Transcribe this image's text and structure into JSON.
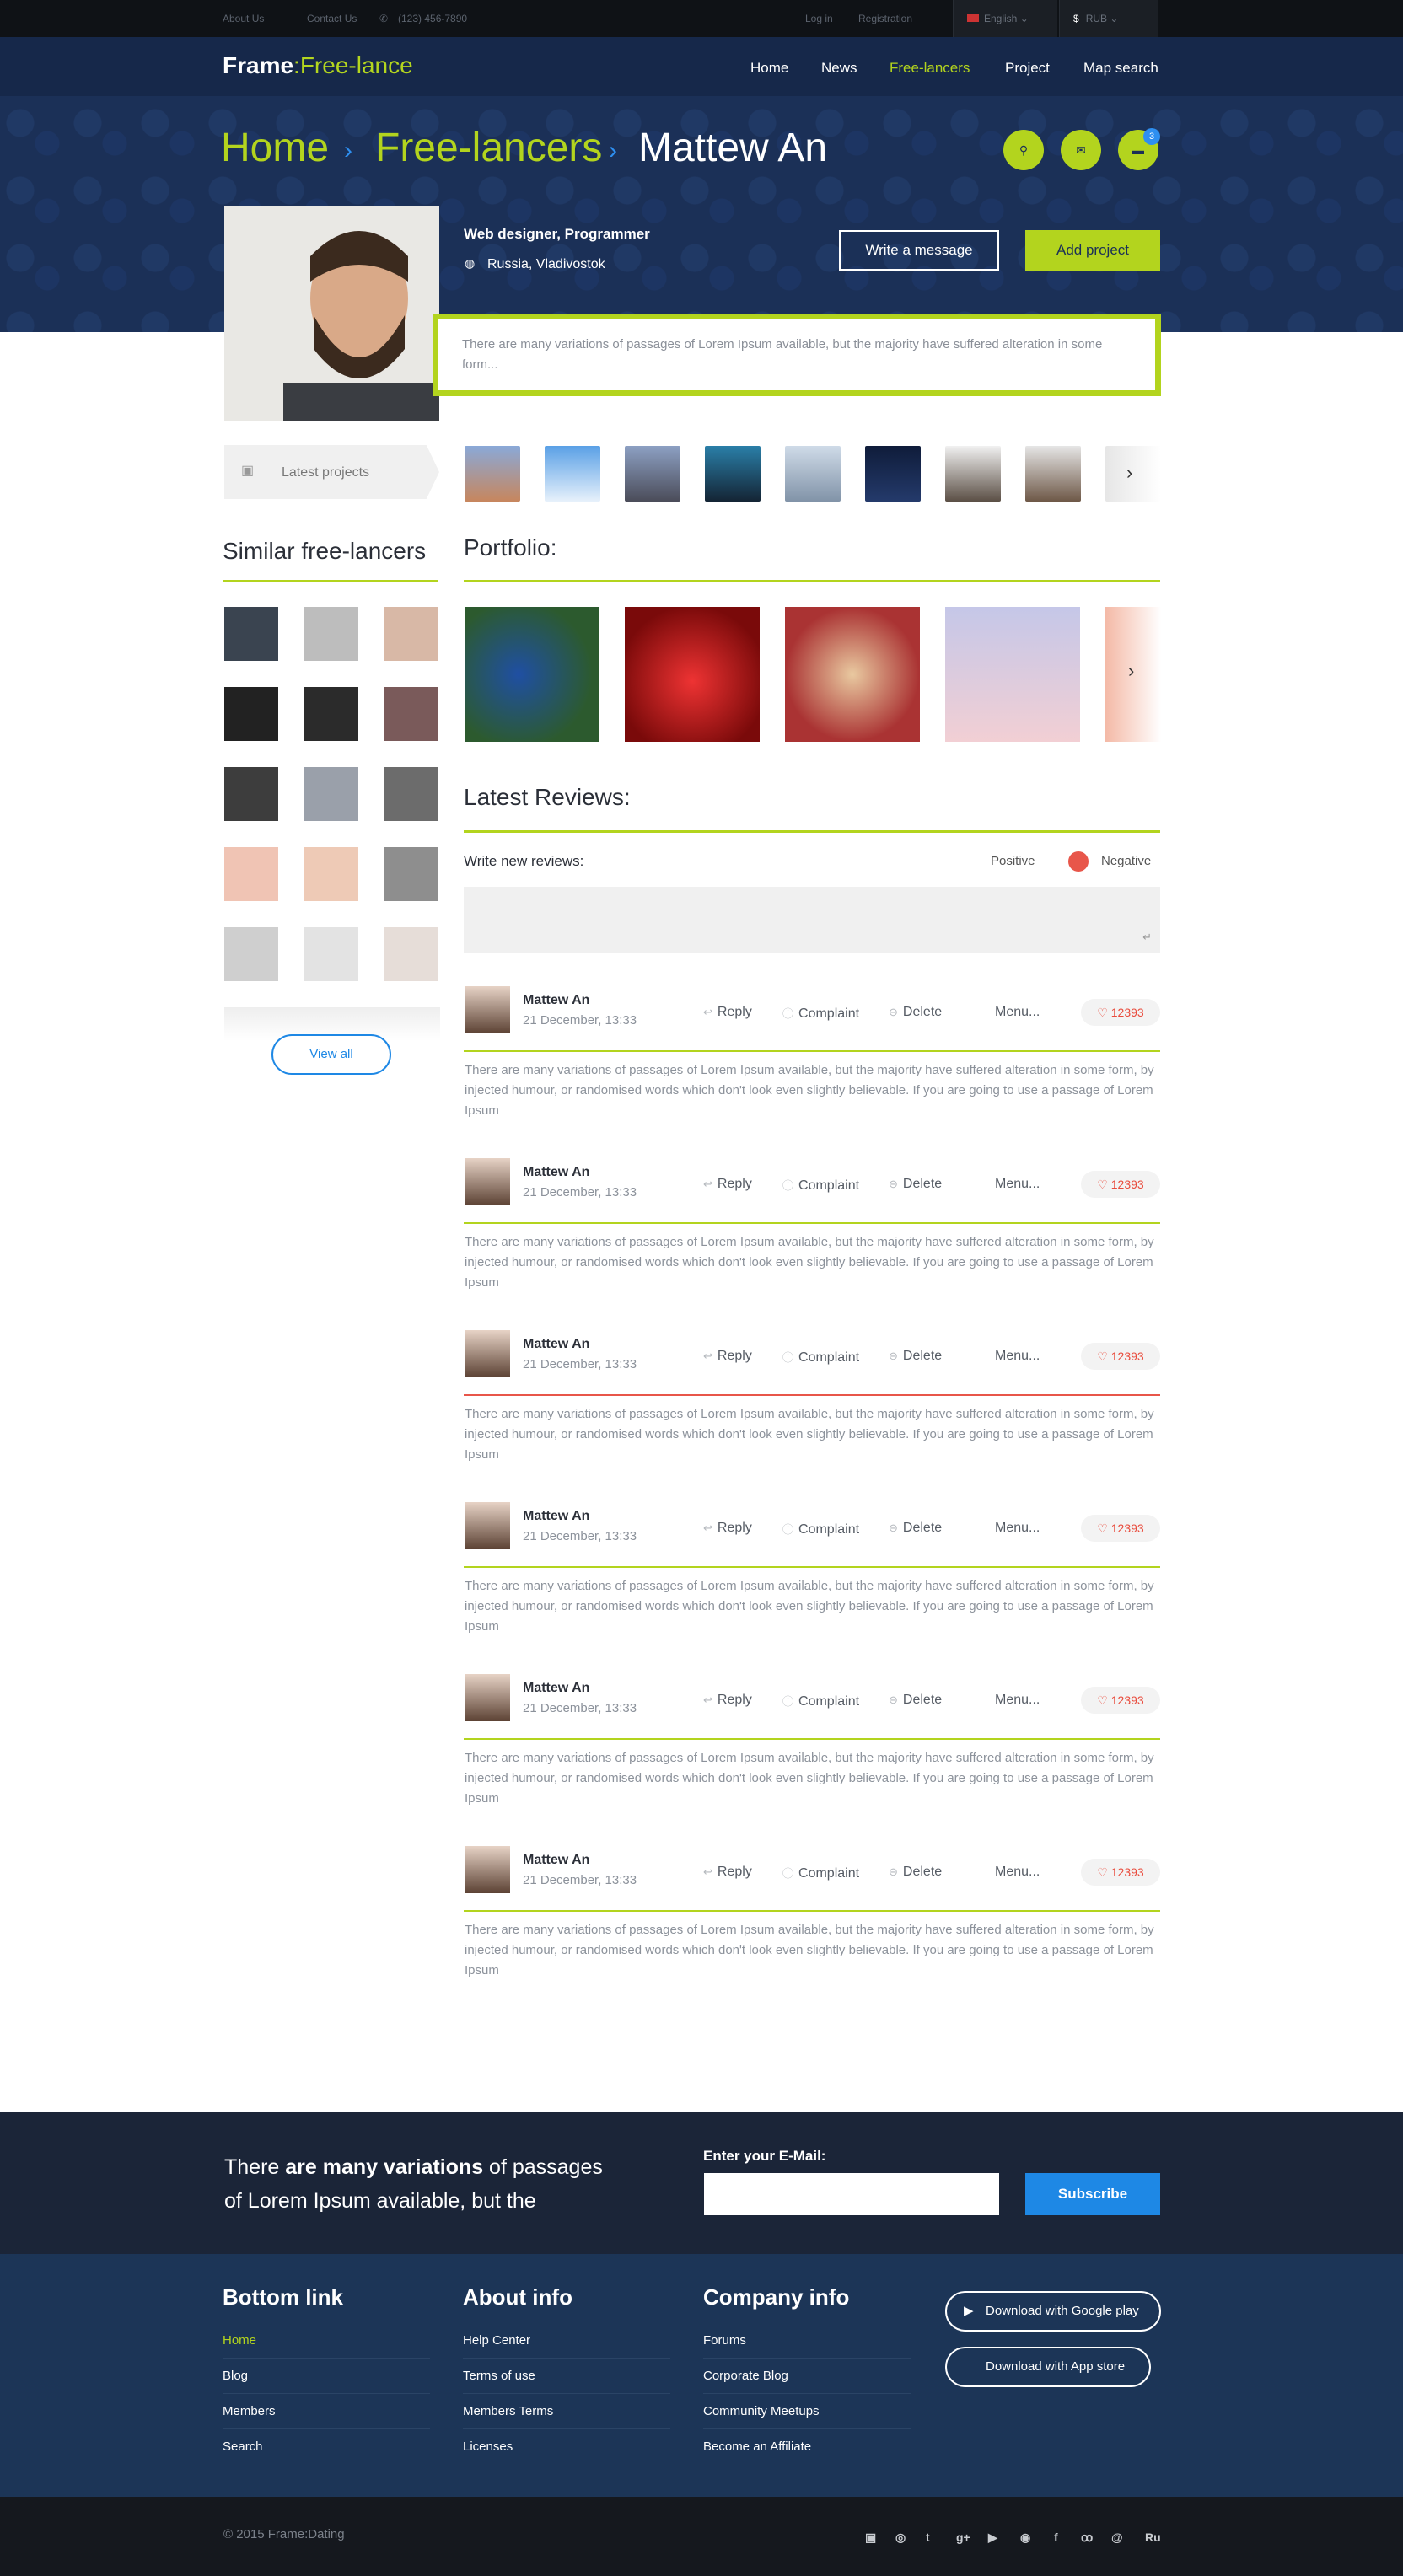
{
  "topbar": {
    "about": "About Us",
    "contact": "Contact Us",
    "phone": "(123) 456-7890",
    "login": "Log in",
    "register": "Registration",
    "language": "English",
    "currency": "RUB"
  },
  "brand": {
    "bold": "Frame",
    "sep": ":",
    "light": "Free-lance"
  },
  "nav": [
    "Home",
    "News",
    "Free-lancers",
    "Project",
    "Map search"
  ],
  "breadcrumb": {
    "home": "Home",
    "section": "Free-lancers",
    "current": "Mattew An"
  },
  "notifications": {
    "count": "3"
  },
  "profile": {
    "role": "Web designer, Programmer",
    "location": "Russia, Vladivostok",
    "write_message": "Write a message",
    "add_project": "Add project",
    "quote": "There are many variations of passages of Lorem Ipsum available, but the majority have suffered alteration in some form..."
  },
  "latest_projects": {
    "label": "Latest projects"
  },
  "similar": {
    "title": "Similar free-lancers",
    "view_all": "View all"
  },
  "portfolio": {
    "title": "Portfolio:"
  },
  "reviews": {
    "title": "Latest Reviews:",
    "write_label": "Write new reviews:",
    "positive": "Positive",
    "negative": "Negative",
    "items": [
      {
        "name": "Mattew An",
        "date": "21 December, 13:33",
        "likes": "12393",
        "text": "There are many variations of passages of Lorem Ipsum available, but the majority have suffered alteration in some form, by injected humour, or randomised words which don't look even slightly believable. If you are going to use a passage of Lorem Ipsum",
        "line": "#b3d41e"
      },
      {
        "name": "Mattew An",
        "date": "21 December, 13:33",
        "likes": "12393",
        "text": "There are many variations of passages of Lorem Ipsum available, but the majority have suffered alteration in some form, by injected humour, or randomised words which don't look even slightly believable. If you are going to use a passage of Lorem Ipsum",
        "line": "#b3d41e"
      },
      {
        "name": "Mattew An",
        "date": "21 December, 13:33",
        "likes": "12393",
        "text": "There are many variations of passages of Lorem Ipsum available, but the majority have suffered alteration in some form, by injected humour, or randomised words which don't look even slightly believable. If you are going to use a passage of Lorem Ipsum",
        "line": "#e8564a"
      },
      {
        "name": "Mattew An",
        "date": "21 December, 13:33",
        "likes": "12393",
        "text": "There are many variations of passages of Lorem Ipsum available, but the majority have suffered alteration in some form, by injected humour, or randomised words which don't look even slightly believable. If you are going to use a passage of Lorem Ipsum",
        "line": "#b3d41e"
      },
      {
        "name": "Mattew An",
        "date": "21 December, 13:33",
        "likes": "12393",
        "text": "There are many variations of passages of Lorem Ipsum available, but the majority have suffered alteration in some form, by injected humour, or randomised words which don't look even slightly believable. If you are going to use a passage of Lorem Ipsum",
        "line": "#b3d41e"
      },
      {
        "name": "Mattew An",
        "date": "21 December, 13:33",
        "likes": "12393",
        "text": "There are many variations of passages of Lorem Ipsum available, but the majority have suffered alteration in some form, by injected humour, or randomised words which don't look even slightly believable. If you are going to use a passage of Lorem Ipsum",
        "line": "#b3d41e"
      }
    ],
    "actions": {
      "reply": "Reply",
      "complaint": "Complaint",
      "delete": "Delete",
      "menu": "Menu..."
    }
  },
  "subscribe": {
    "line1_pre": "There ",
    "line1_bold": "are many variations",
    "line1_post": " of passages",
    "line2": "of Lorem Ipsum available, but the",
    "email_label": "Enter your E-Mail:",
    "button": "Subscribe"
  },
  "footer": {
    "col1": {
      "title": "Bottom link",
      "links": [
        "Home",
        "Blog",
        "Members",
        "Search"
      ]
    },
    "col2": {
      "title": "About info",
      "links": [
        "Help Center",
        "Terms of use",
        "Members Terms",
        "Licenses"
      ]
    },
    "col3": {
      "title": "Company info",
      "links": [
        "Forums",
        "Corporate Blog",
        "Community Meetups",
        "Become an Affiliate"
      ]
    },
    "google": "Download with Google play",
    "appstore": "Download with App store",
    "copyright": "© 2015 Frame:Dating",
    "lang": "Ru"
  },
  "colors": {
    "accent": "#b3d41e",
    "navy": "#1b3057",
    "blue": "#1e88e5",
    "negative": "#e8564a"
  }
}
